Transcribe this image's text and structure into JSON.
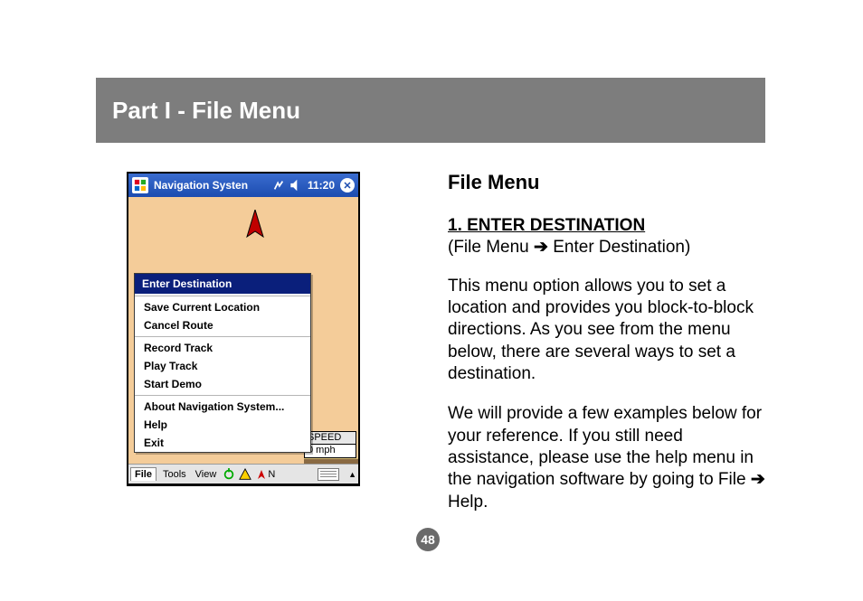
{
  "header": {
    "title": "Part I - File Menu"
  },
  "screenshot": {
    "titlebar": {
      "app_name": "Navigation Systen",
      "time": "11:20"
    },
    "menu": {
      "highlight": "Enter Destination",
      "group1": [
        "Save Current Location",
        "Cancel Route"
      ],
      "group2": [
        "Record Track",
        "Play Track",
        "Start Demo"
      ],
      "group3": [
        "About Navigation System...",
        "Help",
        "Exit"
      ]
    },
    "speed": {
      "label": "SPEED",
      "value": "0 mph"
    },
    "toolbar": {
      "file": "File",
      "tools": "Tools",
      "view": "View",
      "north": "N"
    }
  },
  "content": {
    "section_title": "File Menu",
    "item_title": "1. ENTER DESTINATION",
    "breadcrumb_prefix": "(File Menu ",
    "breadcrumb_suffix": " Enter Destination)",
    "arrow": "➔",
    "para1": "This menu option allows you to set a location and provides you block-to-block directions.  As you see from the menu below, there are several ways to set a destination.",
    "para2_a": "We will provide a few examples below for your reference.  If you still need assistance, please use the help menu in the navigation software by going to File ",
    "para2_b": " Help."
  },
  "page_number": "48"
}
